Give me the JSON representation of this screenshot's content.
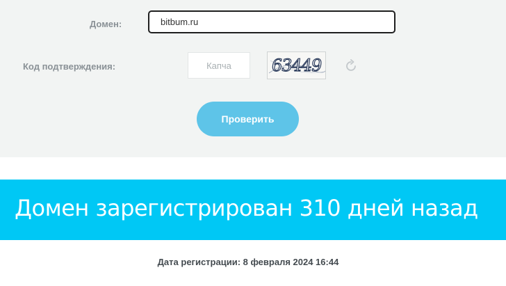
{
  "form": {
    "domain_label": "Домен:",
    "domain_value": "bitbum.ru",
    "code_label": "Код подтверждения:",
    "captcha_placeholder": "Капча",
    "captcha_image_text": "63449",
    "refresh_icon": "refresh-icon",
    "check_button_label": "Проверить"
  },
  "result": {
    "headline": "Домен зарегистрирован 310 дней назад",
    "registration_date": "Дата регистрации: 8 февраля 2024 16:44"
  },
  "colors": {
    "form_background": "#f2f4f3",
    "button": "#5ec4e8",
    "banner": "#00c8f5"
  }
}
